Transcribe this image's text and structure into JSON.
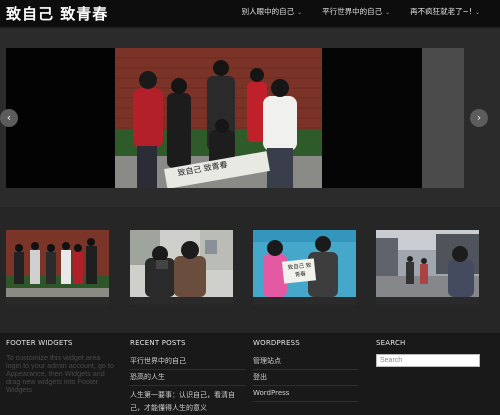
{
  "header": {
    "site_title": "致自己 致青春",
    "nav": [
      {
        "label": "别人眼中的自己"
      },
      {
        "label": "平行世界中的自己"
      },
      {
        "label": "再不疯狂就老了~!"
      }
    ]
  },
  "slider": {
    "banner_text": "致自己   致青春",
    "prev_label": "‹",
    "next_label": "›"
  },
  "thumbs": {
    "thumb3_sign": "致自己 致青春"
  },
  "footer": {
    "widgets": {
      "heading": "FOOTER WIDGETS",
      "text": "To customize this widget area login to your admin account, go to Appearance, then Widgets and drag new widgets into Footer Widgets"
    },
    "recent_posts": {
      "heading": "RECENT POSTS",
      "items": [
        "平行世界中的自己",
        "恐高的人生",
        "人生第一要事：认识自己，看清自己，才能懂得人生的意义"
      ]
    },
    "wordpress": {
      "heading": "WORDPRESS",
      "items": [
        "管理站点",
        "登出",
        "WordPress"
      ]
    },
    "search": {
      "heading": "SEARCH",
      "placeholder": "Search"
    }
  },
  "colors": {
    "header_bg": "#0d0d0d",
    "page_bg": "#262626",
    "footer_bg": "#191919"
  }
}
